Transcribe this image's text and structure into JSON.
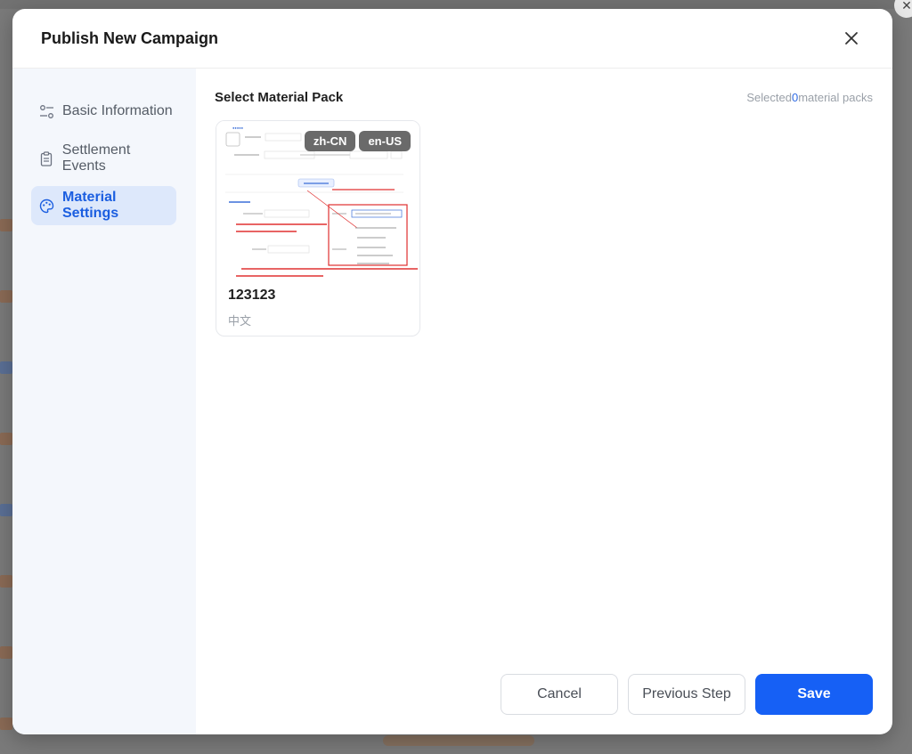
{
  "modal": {
    "title": "Publish New Campaign"
  },
  "sidebar": {
    "items": [
      {
        "label": "Basic Information",
        "icon": "sliders-icon",
        "active": false
      },
      {
        "label": "Settlement Events",
        "icon": "clipboard-icon",
        "active": false
      },
      {
        "label": "Material Settings",
        "icon": "palette-icon",
        "active": true
      }
    ]
  },
  "content": {
    "section_title": "Select Material Pack",
    "selected_prefix": "Selected",
    "selected_count": "0",
    "selected_suffix": "material packs"
  },
  "material_packs": [
    {
      "name": "123123",
      "language": "中文",
      "lang_tags": [
        "zh-CN",
        "en-US"
      ]
    }
  ],
  "footer": {
    "cancel_label": "Cancel",
    "previous_label": "Previous Step",
    "save_label": "Save"
  },
  "colors": {
    "accent": "#1660f5",
    "active_bg": "#dde8fb",
    "sidebar_bg": "#f4f7fc",
    "annotation_red": "#e03030"
  }
}
